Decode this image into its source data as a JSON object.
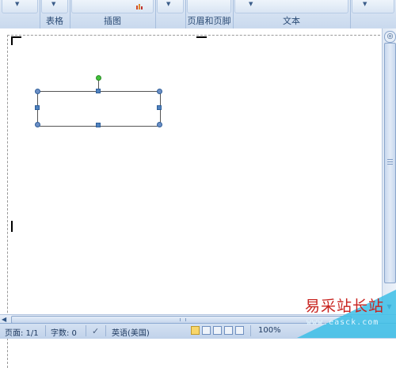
{
  "ribbon": {
    "groups": [
      {
        "label": "表格"
      },
      {
        "label": "插图"
      },
      {
        "label": "页眉和页脚"
      },
      {
        "label": "文本"
      }
    ]
  },
  "status_bar": {
    "page": "页面: 1/1",
    "word_count": "字数: 0",
    "language": "英语(美国)",
    "zoom": "100%"
  },
  "watermark": {
    "title": "易采站长站",
    "url": "www.easck.com"
  },
  "colors": {
    "ribbon_bg": "#c9d9ee",
    "selection_handle": "#4f81bd",
    "rotation_handle": "#41c13a",
    "watermark_red": "#c8231f",
    "watermark_blue": "#3cbee6"
  }
}
